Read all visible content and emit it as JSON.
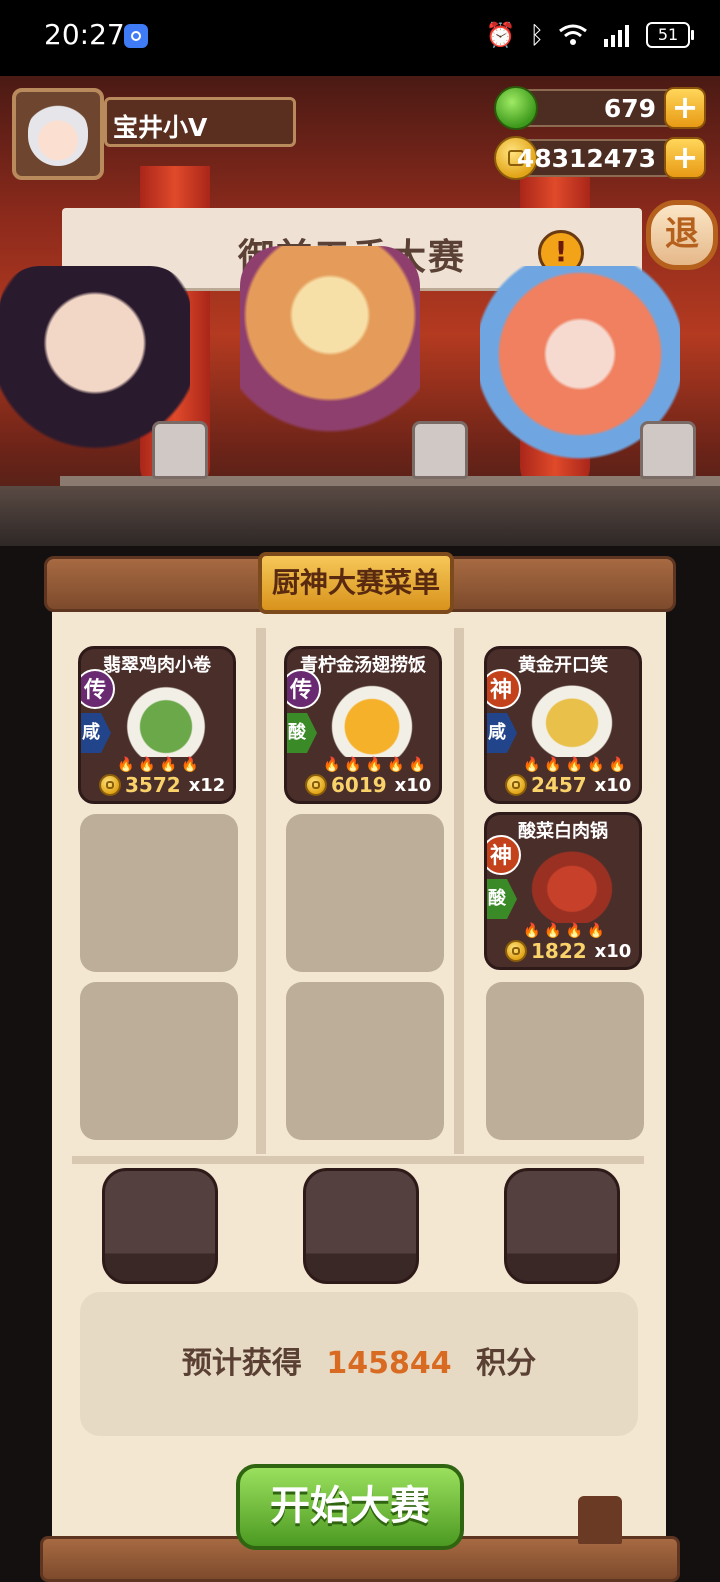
{
  "status_bar": {
    "time": "20:27",
    "icons": [
      "alarm-icon",
      "bluetooth-icon",
      "wifi-icon",
      "signal-icon"
    ],
    "battery": "51"
  },
  "player": {
    "name": "宝井小V",
    "gems": "679",
    "coins": "48312473"
  },
  "event": {
    "title": "御前五香大赛",
    "alert_mark": "!",
    "exit_label": "退"
  },
  "menu": {
    "title": "厨神大赛菜单",
    "columns": [
      {
        "dishes": [
          {
            "name": "翡翠鸡肉小卷",
            "grade": "传",
            "flavor": "咸",
            "price": "3572",
            "qty": "x12",
            "fires": 4
          }
        ]
      },
      {
        "dishes": [
          {
            "name": "青柠金汤翅捞饭",
            "grade": "传",
            "flavor": "酸",
            "price": "6019",
            "qty": "x10",
            "fires": 5
          }
        ]
      },
      {
        "dishes": [
          {
            "name": "黄金开口笑",
            "grade": "神",
            "flavor": "咸",
            "price": "2457",
            "qty": "x10",
            "fires": 5
          },
          {
            "name": "酸菜白肉锅",
            "grade": "神",
            "flavor": "酸",
            "price": "1822",
            "qty": "x10",
            "fires": 4
          }
        ]
      }
    ]
  },
  "score": {
    "prefix": "预计获得",
    "value": "145844",
    "suffix": "积分"
  },
  "start_label": "开始大赛",
  "colors": {
    "accent_orange": "#d86a22",
    "start_green": "#4c9a22",
    "panel_bg": "#f3e7d2",
    "price_gold": "#f9d26a"
  }
}
